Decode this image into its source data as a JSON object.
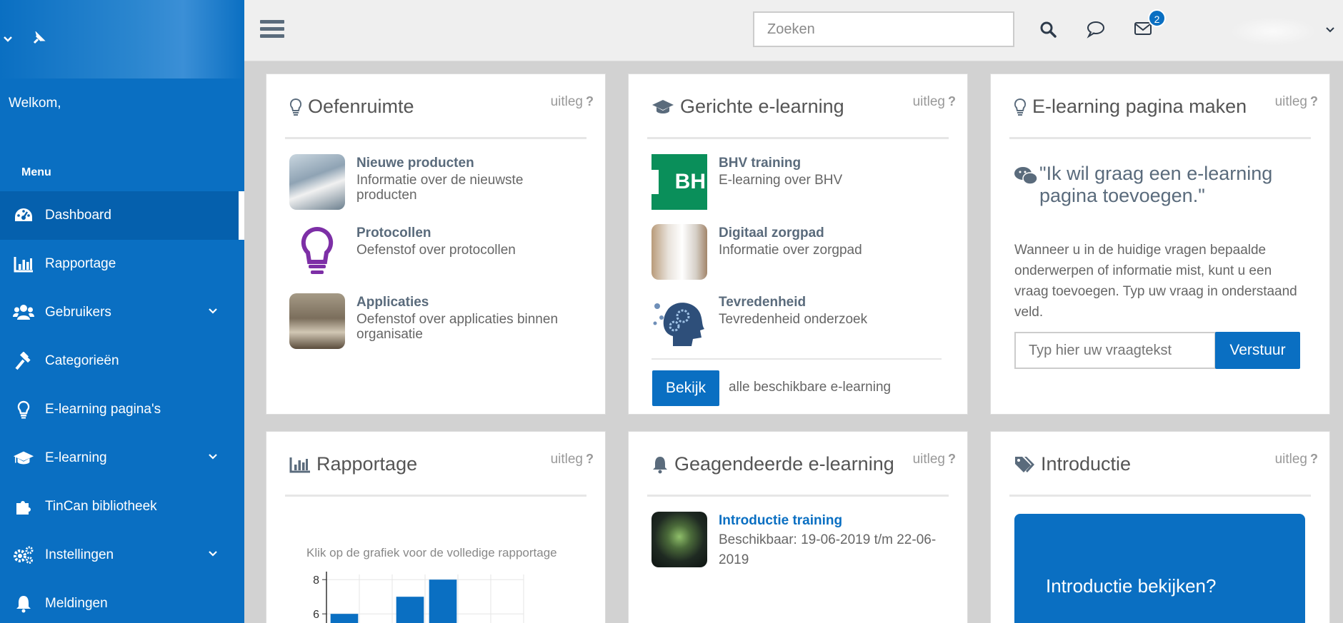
{
  "sidebar": {
    "welcome": "Welkom,",
    "menu_title": "Menu",
    "items": [
      {
        "label": "Dashboard",
        "icon": "dashboard-icon",
        "active": true
      },
      {
        "label": "Rapportage",
        "icon": "bar-chart-icon"
      },
      {
        "label": "Gebruikers",
        "icon": "users-icon",
        "expandable": true
      },
      {
        "label": "Categorieën",
        "icon": "gavel-icon"
      },
      {
        "label": "E-learning pagina's",
        "icon": "lightbulb-icon"
      },
      {
        "label": "E-learning",
        "icon": "graduation-cap-icon",
        "expandable": true
      },
      {
        "label": "TinCan bibliotheek",
        "icon": "puzzle-icon"
      },
      {
        "label": "Instellingen",
        "icon": "gears-icon",
        "expandable": true
      },
      {
        "label": "Meldingen",
        "icon": "bell-icon"
      }
    ]
  },
  "topbar": {
    "search_placeholder": "Zoeken",
    "mail_badge": "2"
  },
  "colors": {
    "brand": "#0a6fc2",
    "text_heading": "#5a6b7c"
  },
  "cards": {
    "oefenruimte": {
      "title": "Oefenruimte",
      "uitleg": "uitleg",
      "items": [
        {
          "title": "Nieuwe producten",
          "desc": "Informatie over de nieuwste producten"
        },
        {
          "title": "Protocollen",
          "desc": "Oefenstof over protocollen"
        },
        {
          "title": "Applicaties",
          "desc": "Oefenstof over applicaties binnen organisatie"
        }
      ]
    },
    "gerichte": {
      "title": "Gerichte e-learning",
      "uitleg": "uitleg",
      "items": [
        {
          "title": "BHV training",
          "desc": "E-learning over BHV",
          "thumb_text": "BH"
        },
        {
          "title": "Digitaal zorgpad",
          "desc": "Informatie over zorgpad"
        },
        {
          "title": "Tevredenheid",
          "desc": "Tevredenheid onderzoek"
        }
      ],
      "button": "Bekijk",
      "button_note": "alle beschikbare e-learning"
    },
    "maken": {
      "title": "E-learning pagina maken",
      "uitleg": "uitleg",
      "quote": "\"Ik wil graag een e-learning pagina toevoegen.\"",
      "text": "Wanneer u in de huidige vragen bepaalde onderwerpen of informatie mist, kunt u een vraag toevoegen. Typ uw vraag in onderstaand veld.",
      "input_placeholder": "Typ hier uw vraagtekst",
      "button": "Verstuur"
    },
    "rapportage": {
      "title": "Rapportage",
      "uitleg": "uitleg",
      "hint": "Klik op de grafiek voor de volledige rapportage"
    },
    "geagendeerde": {
      "title": "Geagendeerde e-learning",
      "uitleg": "uitleg",
      "item_title": "Introductie training",
      "item_desc": "Beschikbaar: 19-06-2019 t/m 22-06-2019"
    },
    "introductie": {
      "title": "Introductie",
      "uitleg": "uitleg",
      "box_text": "Introductie bekijken?"
    }
  },
  "chart_data": {
    "type": "bar",
    "title": "",
    "yticks": [
      6,
      8
    ],
    "ylim": [
      5,
      8.3
    ],
    "values": [
      6,
      null,
      7,
      8,
      null,
      null
    ],
    "grid": true
  }
}
